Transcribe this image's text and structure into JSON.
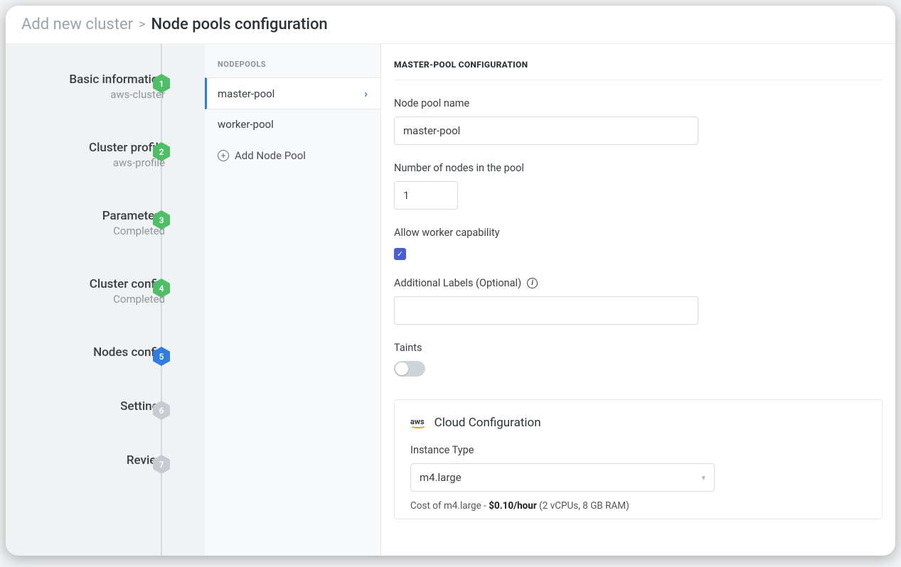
{
  "breadcrumb": {
    "parent": "Add new cluster",
    "current": "Node pools configuration"
  },
  "steps": [
    {
      "title": "Basic information",
      "sub": "aws-cluster",
      "num": "1",
      "state": "done"
    },
    {
      "title": "Cluster profile",
      "sub": "aws-profile",
      "num": "2",
      "state": "done"
    },
    {
      "title": "Parameters",
      "sub": "Completed",
      "num": "3",
      "state": "done"
    },
    {
      "title": "Cluster config",
      "sub": "Completed",
      "num": "4",
      "state": "done"
    },
    {
      "title": "Nodes config",
      "sub": "",
      "num": "5",
      "state": "active"
    },
    {
      "title": "Settings",
      "sub": "",
      "num": "6",
      "state": "todo"
    },
    {
      "title": "Review",
      "sub": "",
      "num": "7",
      "state": "todo"
    }
  ],
  "pools": {
    "header": "NODEPOOLS",
    "items": [
      {
        "label": "master-pool",
        "selected": true
      },
      {
        "label": "worker-pool",
        "selected": false
      }
    ],
    "add_label": "Add Node Pool"
  },
  "config": {
    "title": "MASTER-POOL CONFIGURATION",
    "name_label": "Node pool name",
    "name_value": "master-pool",
    "count_label": "Number of nodes in the pool",
    "count_value": "1",
    "worker_label": "Allow worker capability",
    "worker_checked": true,
    "labels_label": "Additional Labels (Optional)",
    "labels_value": "",
    "taints_label": "Taints",
    "taints_on": false,
    "cloud": {
      "provider_badge": "aws",
      "header": "Cloud Configuration",
      "instance_label": "Instance Type",
      "instance_value": "m4.large",
      "cost_prefix": "Cost of m4.large - ",
      "cost_bold": "$0.10/hour",
      "cost_suffix": " (2 vCPUs, 8 GB RAM)"
    }
  }
}
